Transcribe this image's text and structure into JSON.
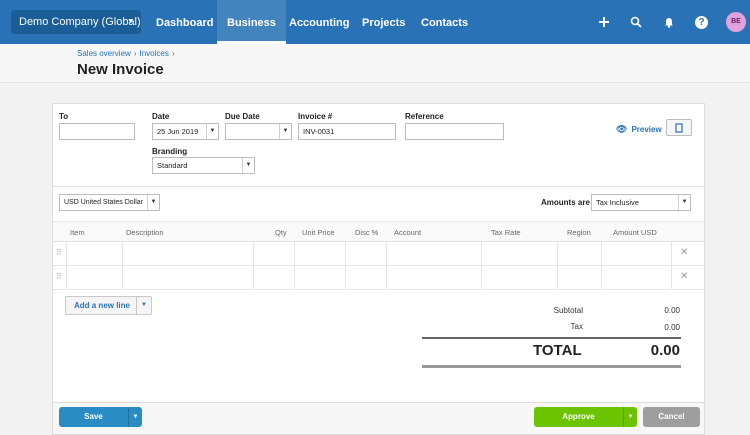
{
  "topnav": {
    "org": "Demo Company (Global)",
    "links": [
      "Dashboard",
      "Business",
      "Accounting",
      "Projects",
      "Contacts"
    ],
    "active_link": "Business",
    "icons": [
      "plus-icon",
      "search-icon",
      "bell-icon",
      "help-icon"
    ],
    "help_glyph": "?",
    "avatar_initials": "BE"
  },
  "breadcrumb": {
    "items": [
      "Sales overview",
      "Invoices"
    ]
  },
  "page_title": "New Invoice",
  "form": {
    "to_label": "To",
    "to_value": "",
    "date_label": "Date",
    "date_value": "25 Jun 2019",
    "due_date_label": "Due Date",
    "due_date_value": "",
    "invoice_label": "Invoice #",
    "invoice_value": "INV-0031",
    "reference_label": "Reference",
    "reference_value": "",
    "branding_label": "Branding",
    "branding_value": "Standard",
    "preview_label": "Preview",
    "currency_value": "USD United States Dollar",
    "amounts_are_label": "Amounts are",
    "amounts_are_value": "Tax Inclusive"
  },
  "table": {
    "columns": [
      "Item",
      "Description",
      "Qty",
      "Unit Price",
      "Disc %",
      "Account",
      "Tax Rate",
      "Region",
      "Amount USD"
    ],
    "rows": [
      {
        "item": "",
        "description": "",
        "qty": "",
        "unit_price": "",
        "disc": "",
        "account": "",
        "tax_rate": "",
        "region": "",
        "amount": ""
      },
      {
        "item": "",
        "description": "",
        "qty": "",
        "unit_price": "",
        "disc": "",
        "account": "",
        "tax_rate": "",
        "region": "",
        "amount": ""
      }
    ],
    "add_line_label": "Add a new line"
  },
  "totals": {
    "subtotal_label": "Subtotal",
    "subtotal_value": "0.00",
    "tax_label": "Tax",
    "tax_value": "0.00",
    "total_label": "TOTAL",
    "total_value": "0.00"
  },
  "footer": {
    "save_label": "Save",
    "approve_label": "Approve",
    "cancel_label": "Cancel"
  },
  "colors": {
    "nav_bg": "#2a72b6",
    "save_btn": "#2b8cc4",
    "approve_btn": "#6cc400",
    "cancel_btn": "#9e9e9e"
  }
}
